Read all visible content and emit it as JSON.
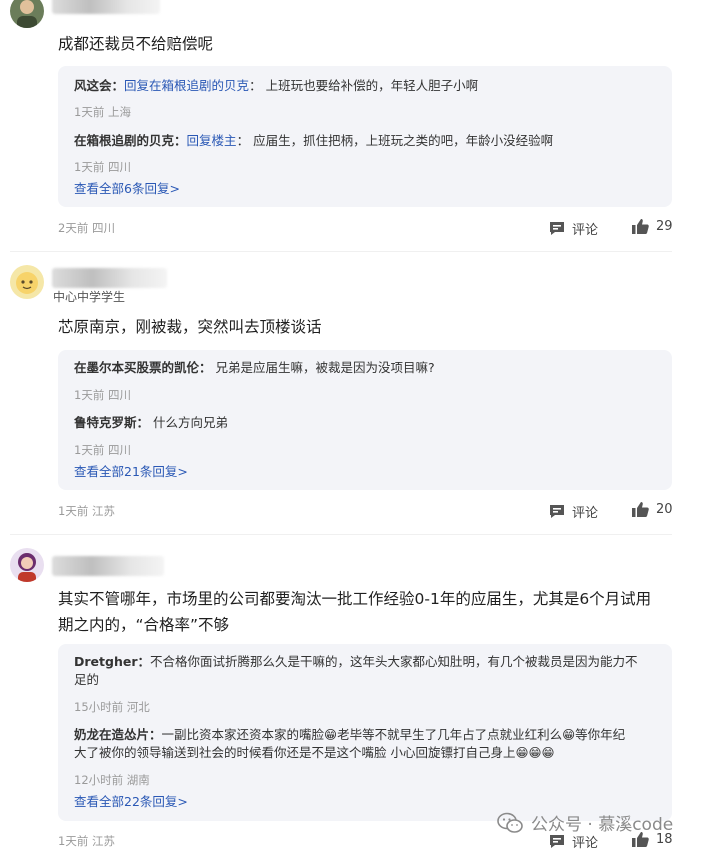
{
  "comments": [
    {
      "text": "成都还裁员不给赔偿呢",
      "replies": [
        {
          "author": "风这会",
          "prefix": "回复",
          "target": "在箱根追剧的贝克",
          "text": "上班玩也要给补偿的，年轻人胆子小啊",
          "time": "1天前",
          "location": "上海"
        },
        {
          "author": "在箱根追剧的贝克",
          "prefix": "回复",
          "target": "楼主",
          "text": "应届生，抓住把柄，上班玩之类的吧，年龄小没经验啊",
          "time": "1天前",
          "location": "四川"
        }
      ],
      "more": "查看全部6条回复>",
      "time": "2天前",
      "location": "四川",
      "comment_label": "评论",
      "likes": "29"
    },
    {
      "subtitle": "中心中学学生",
      "text": "芯原南京，刚被裁，突然叫去顶楼谈话",
      "replies": [
        {
          "author": "在墨尔本买股票的凯伦",
          "text": "兄弟是应届生嘛，被裁是因为没项目嘛?",
          "time": "1天前",
          "location": "四川"
        },
        {
          "author": "鲁特克罗斯",
          "text": "什么方向兄弟",
          "time": "1天前",
          "location": "四川"
        }
      ],
      "more": "查看全部21条回复>",
      "time": "1天前",
      "location": "江苏",
      "comment_label": "评论",
      "likes": "20"
    },
    {
      "text_line1": "其实不管哪年，市场里的公司都要淘汰一批工作经验0-1年的应届生，尤其是6个月试用",
      "text_line2": "期之内的，“合格率”不够",
      "replies": [
        {
          "author": "Dretgher",
          "text_line1": "不合格你面试折腾那么久是干嘛的，这年头大家都心知肚明，有几个被裁员是因为能力不",
          "text_line2": "足的",
          "time": "15小时前",
          "location": "河北"
        },
        {
          "author": "奶龙在造怂片",
          "text_line1": "一副比资本家还资本家的嘴脸😁老毕等不就早生了几年占了点就业红利么😁等你年纪",
          "text_line2": "大了被你的领导输送到社会的时候看你还是不是这个嘴脸 小心回旋镖打自己身上😁😁😁",
          "time": "12小时前",
          "location": "湖南"
        }
      ],
      "more": "查看全部22条回复>",
      "time": "1天前",
      "location": "江苏",
      "comment_label": "评论",
      "likes": "18"
    }
  ],
  "watermark": {
    "text": "公众号 · 慕溪code",
    "icon": "wechat-icon"
  },
  "colors": {
    "link": "#2a58b5",
    "reply_bg": "#f3f4f8",
    "meta": "#9a9a9a"
  }
}
